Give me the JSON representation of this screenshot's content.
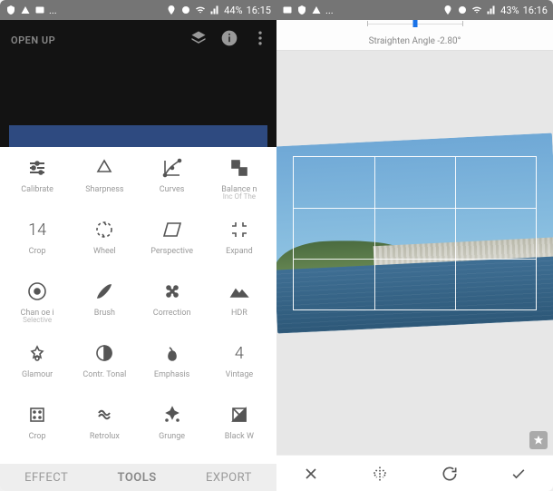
{
  "statusbar_left": {
    "battery": "44%",
    "time": "16:15"
  },
  "statusbar_right": {
    "battery": "43%",
    "time": "16:16"
  },
  "left_phone": {
    "app_title": "OPEN UP",
    "tools": [
      {
        "id": "calibrate",
        "label": "Calibrate"
      },
      {
        "id": "sharpness",
        "label": "Sharpness"
      },
      {
        "id": "curves",
        "label": "Curves"
      },
      {
        "id": "balance",
        "label": "Balance n",
        "sublabel": "Inc Of The"
      },
      {
        "id": "crop",
        "label": "Crop",
        "text_icon": "14"
      },
      {
        "id": "wheel",
        "label": "Wheel"
      },
      {
        "id": "perspective",
        "label": "Perspective"
      },
      {
        "id": "expand",
        "label": "Expand"
      },
      {
        "id": "selective",
        "label": "Chan oe i",
        "sublabel": "Selective"
      },
      {
        "id": "brush",
        "label": "Brush"
      },
      {
        "id": "correction",
        "label": "Correction"
      },
      {
        "id": "hdr",
        "label": "HDR"
      },
      {
        "id": "glamour",
        "label": "Glamour"
      },
      {
        "id": "tonal",
        "label": "Contr. Tonal"
      },
      {
        "id": "emphasis",
        "label": "Emphasis"
      },
      {
        "id": "vintage",
        "label": "Vintage",
        "text_icon": "4"
      },
      {
        "id": "crop2",
        "label": "Crop"
      },
      {
        "id": "retrolux",
        "label": "Retrolux"
      },
      {
        "id": "grunge",
        "label": "Grunge"
      },
      {
        "id": "bw",
        "label": "Black W"
      }
    ],
    "tabs": {
      "effect": "EFFECT",
      "tools": "TOOLS",
      "export": "EXPORT"
    }
  },
  "right_phone": {
    "angle_label": "Straighten Angle -2.80°",
    "angle_value": -2.8
  }
}
